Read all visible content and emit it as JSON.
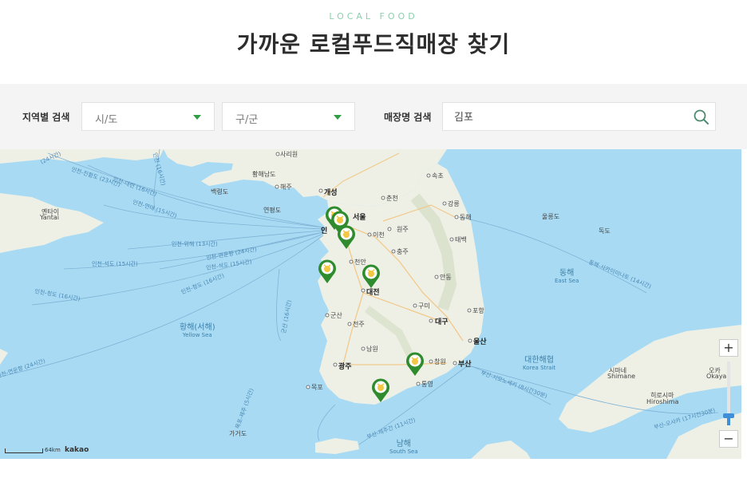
{
  "header": {
    "eyebrow": "LOCAL FOOD",
    "title": "가까운 로컬푸드직매장 찾기"
  },
  "search": {
    "region_label": "지역별 검색",
    "sido_value": "시/도",
    "gugun_value": "구/군",
    "store_label": "매장명 검색",
    "store_value": "김포"
  },
  "map": {
    "places": {
      "sariwon": "사리원",
      "haeju": "해주",
      "gaeseong": "개성",
      "baengnyeong": "백령도",
      "yeonpyeong": "연평도",
      "chuncheon": "춘천",
      "sokcho": "속초",
      "gangneung": "강릉",
      "donghae": "동해",
      "ulleungdo": "울릉도",
      "dokdo": "독도",
      "seoul": "서울",
      "incheon": "인",
      "icheon": "이천",
      "wonju": "원주",
      "chungju": "충주",
      "taebaek": "태백",
      "cheonan": "천안",
      "daejeon": "대전",
      "andong": "안동",
      "gumi": "구미",
      "daegu": "대구",
      "pohang": "포항",
      "ulsan": "울산",
      "busan": "부산",
      "changwon": "창원",
      "tongyeong": "통영",
      "gunsan": "군산",
      "jeonju": "전주",
      "namwon": "남원",
      "gwangju": "광주",
      "mokpo": "목포",
      "gageodo": "가거도",
      "yantai": "옌타이",
      "yantai_en": "Yantai",
      "hwanghaenamdo": "황해남도",
      "shimane": "시마네",
      "shimane_en": "Shimane",
      "hiroshima": "히로시마",
      "hiroshima_en": "Hiroshima",
      "okayama": "오카",
      "okayama_en": "Okaya",
      "cheonju_partial": "주"
    },
    "seas": {
      "east_ko": "동해",
      "east_en": "East Sea",
      "yellow_ko": "황해(서해)",
      "yellow_en": "Yellow Sea",
      "south_ko": "남해",
      "south_en": "South Sea",
      "strait_ko": "대한해협",
      "strait_en": "Korea Strait"
    },
    "routes": {
      "r1": "인천-대련 (16시간)",
      "r2": "인천-진황도 (23시간)",
      "r3": "인천-연태 (15시간)",
      "r4": "인천-위해 (13시간)",
      "r5": "인천-연운항 (24시간)",
      "r6": "인천-석도 (15시간)",
      "r7": "인천-석도 (15시간)",
      "r8": "인천-청도 (16시간)",
      "r9": "인천-청도 (16시간)",
      "r10": "인천-연운항 (24시간)",
      "r11": "동해-사카이미나토 (14시간)",
      "r12": "부산-시모노세키 (8시간30분)",
      "r13": "부산-제주간 (11시간)",
      "r14": "부산-오사카 (17시간30분)",
      "r15": "군산 (16시간)",
      "r16": "목포-제주 (5시간)",
      "r17": "(24시간)",
      "r18": "인천 (16시간)"
    },
    "scale_label": "64km",
    "logo": "kakao",
    "zoom_in": "+",
    "zoom_out": "−",
    "zoom_level_fraction": 0.15
  },
  "colors": {
    "accent": "#2f9e44",
    "eyebrow": "#8ccfae",
    "sea": "#a8dbf3",
    "land": "#eef0e6",
    "pin_green": "#2e8b2e",
    "pin_inner": "#f2c744"
  }
}
